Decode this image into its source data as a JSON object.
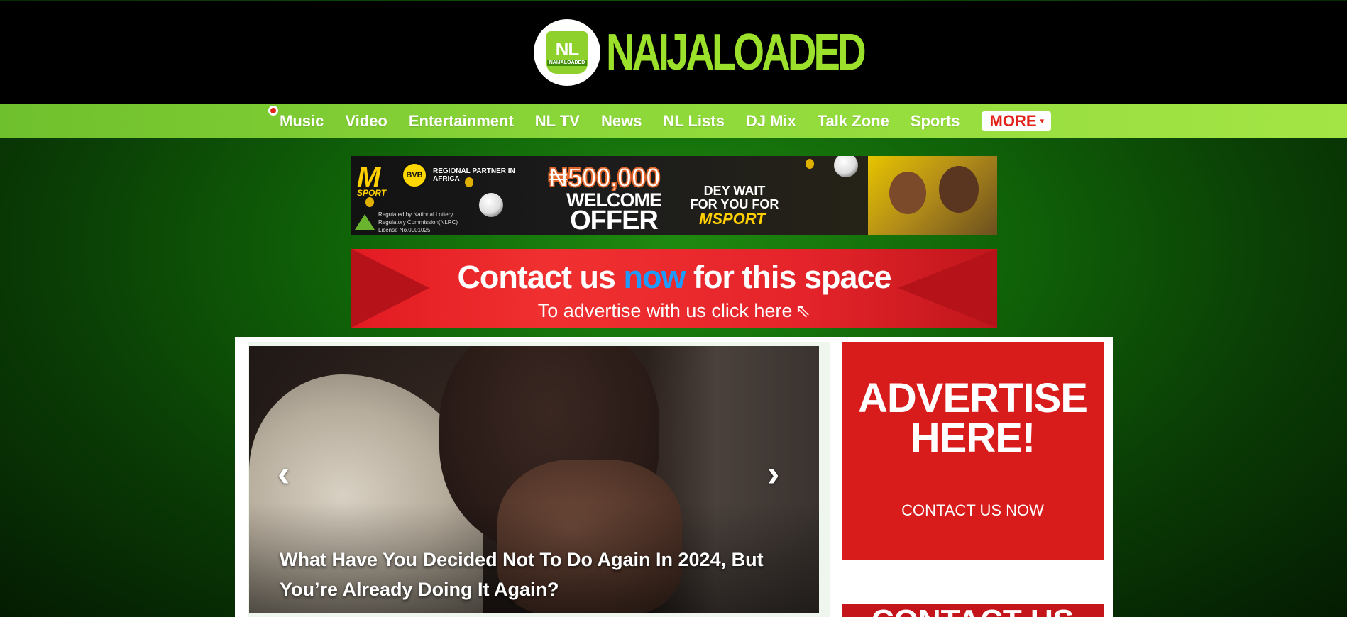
{
  "brand": {
    "logo_badge_text": "NL",
    "logo_badge_subtext": "NAIJALOADED",
    "name": "NAIJALOADED",
    "accent_color": "#9be02a"
  },
  "nav": {
    "items": [
      {
        "label": "Music"
      },
      {
        "label": "Video"
      },
      {
        "label": "Entertainment"
      },
      {
        "label": "NL TV"
      },
      {
        "label": "News"
      },
      {
        "label": "NL Lists"
      },
      {
        "label": "DJ Mix"
      },
      {
        "label": "Talk Zone"
      },
      {
        "label": "Sports"
      }
    ],
    "more_label": "MORE",
    "more_icon": "caret-down-icon"
  },
  "ad_msport": {
    "brand": "M",
    "brand_sub": "SPORT",
    "club_badge": "BVB",
    "partner_text": "REGIONAL PARTNER IN AFRICA",
    "regulation_text": "Regulated by National Lottery Regulatory Commission(NLRC) License No.0001025",
    "amount": "₦500,000",
    "welcome": "WELCOME",
    "offer": "OFFER",
    "tagline": "DEY WAIT FOR YOU FOR",
    "tagline_brand": "MSPORT"
  },
  "ad_contact": {
    "line1_before": "Contact us ",
    "line1_highlight": "now",
    "line1_after": " for this space",
    "line2": "To advertise with us click here"
  },
  "slider": {
    "caption": "What Have You Decided Not To Do Again In 2024, But You’re Already Doing It Again?",
    "prev_icon": "chevron-left-icon",
    "next_icon": "chevron-right-icon"
  },
  "sidebar": {
    "advertise_title_line1": "ADVERTISE",
    "advertise_title_line2": "HERE!",
    "advertise_cta": "CONTACT US NOW",
    "second_banner_title": "CONTACT US"
  }
}
